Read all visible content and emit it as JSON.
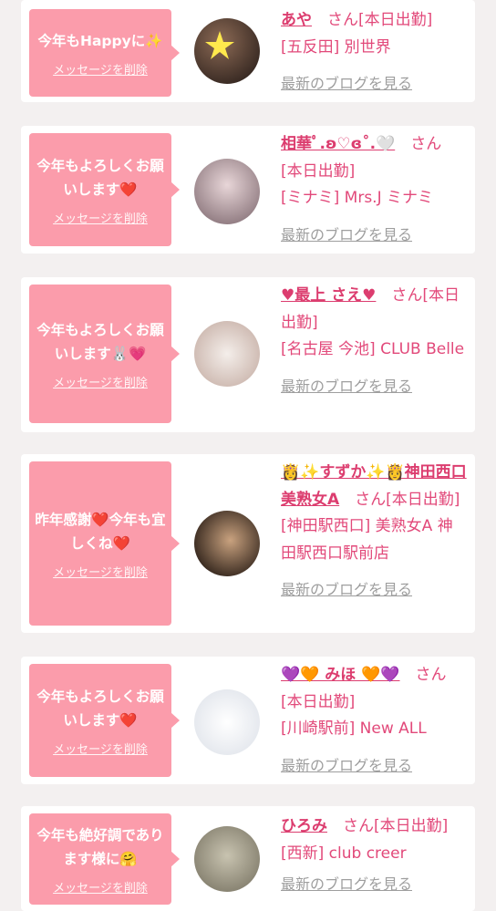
{
  "cards": [
    {
      "message": "今年もHappyに✨",
      "delete_label": "メッセージを削除",
      "name": "あや",
      "suffix": "さん[本日出勤]",
      "shop": "[五反田] 別世界",
      "blog_label": "最新のブログを見る",
      "avatar_colors": [
        "#6b5346",
        "#3a2b24"
      ]
    },
    {
      "message": "今年もよろしくお願いします❤️",
      "delete_label": "メッセージを削除",
      "name": "相華ﾟ.ʚ♡ɞ˚.🤍",
      "suffix": "さん",
      "line2": "[本日出勤]",
      "shop": "[ミナミ] Mrs.J ミナミ",
      "blog_label": "最新のブログを見る",
      "avatar_colors": [
        "#d9c2c6",
        "#8f7a80"
      ]
    },
    {
      "message": "今年もよろしくお願いします🐰💗",
      "delete_label": "メッセージを削除",
      "name": "♥最上 さえ♥",
      "suffix": "さん[本日出勤]",
      "shop": "[名古屋 今池] CLUB Belle",
      "blog_label": "最新のブログを見る",
      "avatar_colors": [
        "#ece6e2",
        "#c9b3aa"
      ]
    },
    {
      "message": "昨年感謝❤️今年も宜しくね❤️",
      "delete_label": "メッセージを削除",
      "name": "👸✨すずか✨👸神田西口美熟女A",
      "suffix": "さん[本日出勤]",
      "shop": "[神田駅西口] 美熟女A 神田駅西口駅前店",
      "blog_label": "最新のブログを見る",
      "avatar_colors": [
        "#6e5540",
        "#2e2119"
      ]
    },
    {
      "message": "今年もよろしくお願いします❤️",
      "delete_label": "メッセージを削除",
      "name": "💜🧡 みほ 🧡💜",
      "suffix": "さん",
      "line2": "[本日出勤]",
      "shop": "[川崎駅前] New ALL",
      "blog_label": "最新のブログを見る",
      "avatar_colors": [
        "#ffffff",
        "#dfe3ea"
      ]
    },
    {
      "message": "今年も絶好調であります様に🤗",
      "delete_label": "メッセージを削除",
      "name": "ひろみ",
      "suffix": "さん[本日出勤]",
      "shop": "[西新] club creer",
      "blog_label": "最新のブログを見る",
      "avatar_colors": [
        "#b7b29f",
        "#7f7a69"
      ]
    }
  ]
}
